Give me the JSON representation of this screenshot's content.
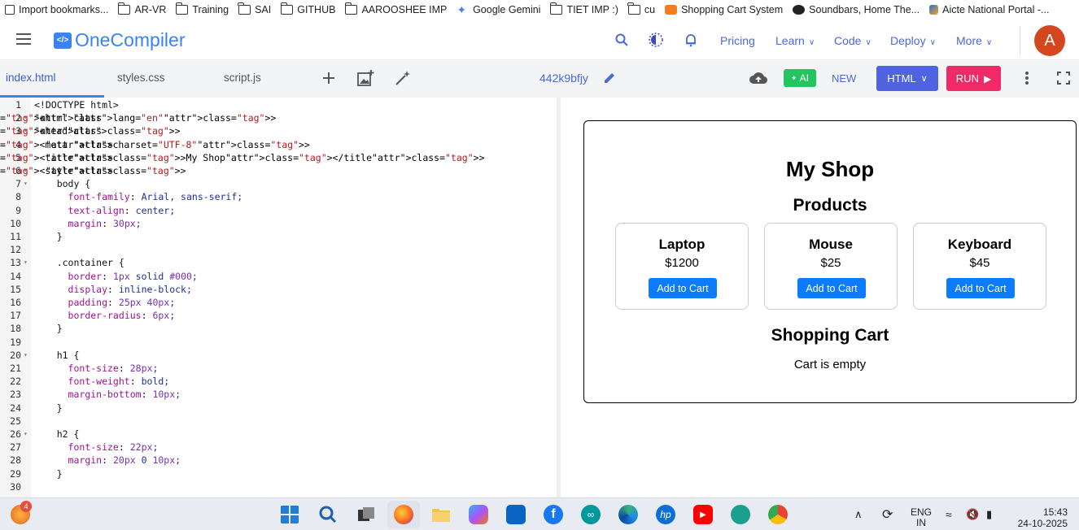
{
  "bookmarks": [
    {
      "label": "Import bookmarks...",
      "icon": "import-icon"
    },
    {
      "label": "AR-VR",
      "icon": "folder-icon"
    },
    {
      "label": "Training",
      "icon": "folder-icon"
    },
    {
      "label": "SAI",
      "icon": "folder-icon"
    },
    {
      "label": "GITHUB",
      "icon": "folder-icon"
    },
    {
      "label": "AAROOSHEE IMP",
      "icon": "folder-icon"
    },
    {
      "label": "Google Gemini",
      "icon": "gemini-icon"
    },
    {
      "label": "TIET IMP :)",
      "icon": "folder-icon"
    },
    {
      "label": "cu",
      "icon": "folder-icon"
    },
    {
      "label": "Shopping Cart System",
      "icon": "site-icon"
    },
    {
      "label": "Soundbars, Home The...",
      "icon": "site-icon"
    },
    {
      "label": "Aicte National Portal -...",
      "icon": "site-icon"
    }
  ],
  "header": {
    "logo": "OneCompiler",
    "nav": {
      "pricing": "Pricing",
      "learn": "Learn",
      "code": "Code",
      "deploy": "Deploy",
      "more": "More"
    },
    "avatar": "A"
  },
  "toolbar": {
    "tabs": [
      "index.html",
      "styles.css",
      "script.js"
    ],
    "filename": "442k9bfjy",
    "ai": "AI",
    "new": "NEW",
    "language": "HTML",
    "run": "RUN"
  },
  "editor": {
    "lines": [
      "<!DOCTYPE html>",
      "<html lang=\"en\">",
      "<head>",
      "  <meta charset=\"UTF-8\">",
      "  <title>My Shop</title>",
      "  <style>",
      "    body {",
      "      font-family: Arial, sans-serif;",
      "      text-align: center;",
      "      margin: 30px;",
      "    }",
      "",
      "    .container {",
      "      border: 1px solid #000;",
      "      display: inline-block;",
      "      padding: 25px 40px;",
      "      border-radius: 6px;",
      "    }",
      "",
      "    h1 {",
      "      font-size: 28px;",
      "      font-weight: bold;",
      "      margin-bottom: 10px;",
      "    }",
      "",
      "    h2 {",
      "      font-size: 22px;",
      "      margin: 20px 0 10px;",
      "    }",
      ""
    ]
  },
  "preview": {
    "title": "My Shop",
    "products_heading": "Products",
    "products": [
      {
        "name": "Laptop",
        "price": "$1200",
        "button": "Add to Cart"
      },
      {
        "name": "Mouse",
        "price": "$25",
        "button": "Add to Cart"
      },
      {
        "name": "Keyboard",
        "price": "$45",
        "button": "Add to Cart"
      }
    ],
    "cart_heading": "Shopping Cart",
    "cart_status": "Cart is empty"
  },
  "taskbar": {
    "notification_badge": "4",
    "language": "ENG",
    "region": "IN",
    "time": "15:43",
    "date": "24-10-2025"
  }
}
